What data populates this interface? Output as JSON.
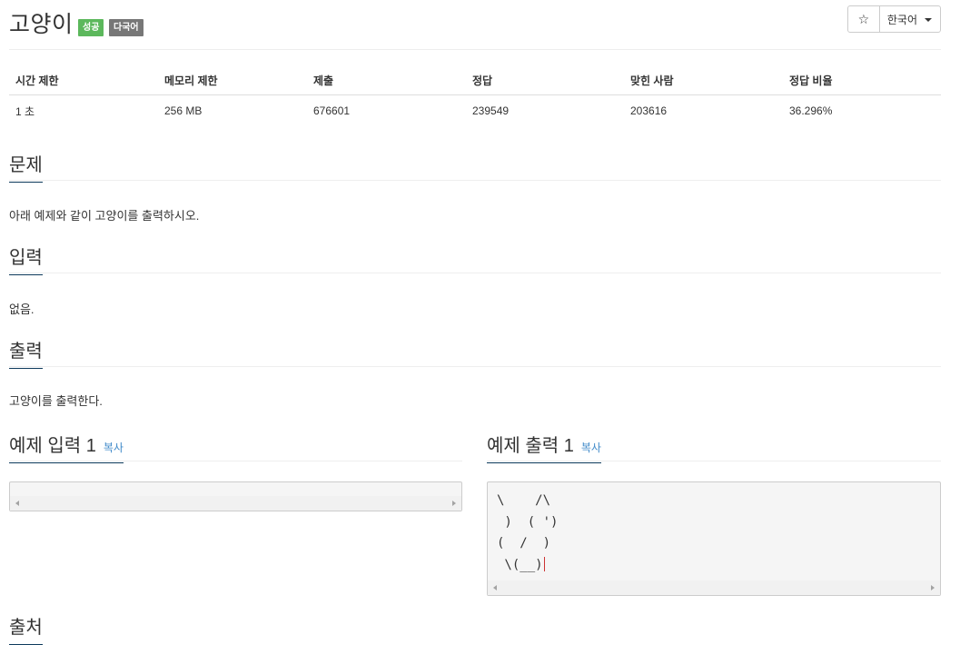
{
  "header": {
    "title": "고양이",
    "badge_success": "성공",
    "badge_multilang": "다국어",
    "star_icon": "☆",
    "language": "한국어"
  },
  "info": {
    "headers": [
      "시간 제한",
      "메모리 제한",
      "제출",
      "정답",
      "맞힌 사람",
      "정답 비율"
    ],
    "values": [
      "1 초",
      "256 MB",
      "676601",
      "239549",
      "203616",
      "36.296%"
    ]
  },
  "problem": {
    "title": "문제",
    "text": "아래 예제와 같이 고양이를 출력하시오."
  },
  "input": {
    "title": "입력",
    "text": "없음."
  },
  "output": {
    "title": "출력",
    "text": "고양이를 출력한다."
  },
  "sample_input": {
    "title": "예제 입력 1",
    "copy": "복사",
    "content": ""
  },
  "sample_output": {
    "title": "예제 출력 1",
    "copy": "복사",
    "content": "\\    /\\\n )  ( ')\n(  /  )\n \\(__)"
  },
  "next_section": {
    "title": "출처"
  },
  "colors": {
    "success": "#5cb85c",
    "multilang": "#777777",
    "link": "#428bca",
    "heading_underline": "#0d3a5c"
  }
}
